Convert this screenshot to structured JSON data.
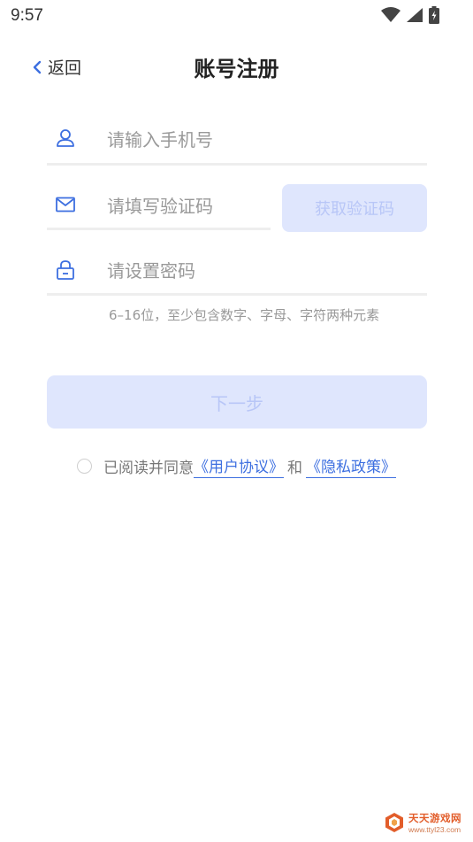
{
  "status_bar": {
    "time": "9:57",
    "icons": [
      "wifi-icon",
      "signal-icon",
      "battery-icon"
    ]
  },
  "nav": {
    "back_label": "返回",
    "title": "账号注册"
  },
  "form": {
    "phone": {
      "placeholder": "请输入手机号",
      "value": "",
      "icon": "user-icon"
    },
    "code": {
      "placeholder": "请填写验证码",
      "value": "",
      "icon": "mail-icon"
    },
    "get_code_label": "获取验证码",
    "password": {
      "placeholder": "请设置密码",
      "value": "",
      "icon": "lock-icon"
    },
    "password_hint": "6–16位，至少包含数字、字母、字符两种元素",
    "next_label": "下一步"
  },
  "agreement": {
    "prefix": "已阅读并同意",
    "user_agreement": "《用户协议》",
    "and": "和",
    "privacy_policy": "《隐私政策》",
    "checked": false
  },
  "watermark": {
    "name": "天天游戏网",
    "url": "www.ttyl23.com"
  },
  "colors": {
    "accent": "#3d6fe0",
    "disabled_button_bg": "#dfe6fd",
    "disabled_button_text": "#b8c6f7",
    "divider": "#eeeeee",
    "hint_text": "#999999"
  }
}
